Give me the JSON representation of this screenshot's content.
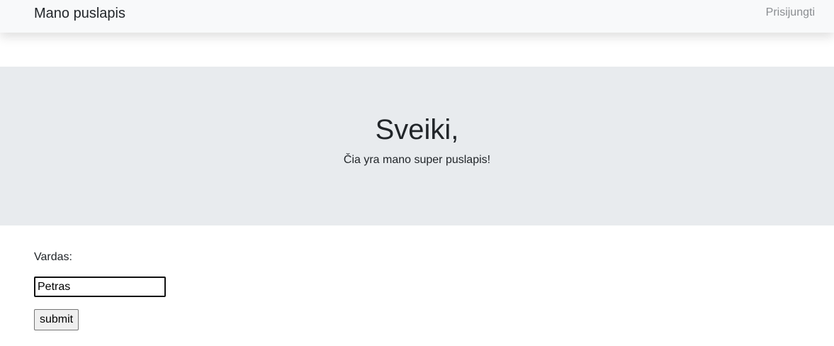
{
  "navbar": {
    "brand": "Mano puslapis",
    "login_link": "Prisijungti"
  },
  "hero": {
    "title": "Sveiki,",
    "subtitle": "Čia yra mano super puslapis!"
  },
  "form": {
    "name_label": "Vardas:",
    "name_value": "Petras",
    "submit_label": "submit"
  },
  "colors": {
    "navbar_bg": "#f8f9fa",
    "hero_bg": "#e8ebee",
    "text": "#212529",
    "muted_link": "#8a8d91"
  }
}
